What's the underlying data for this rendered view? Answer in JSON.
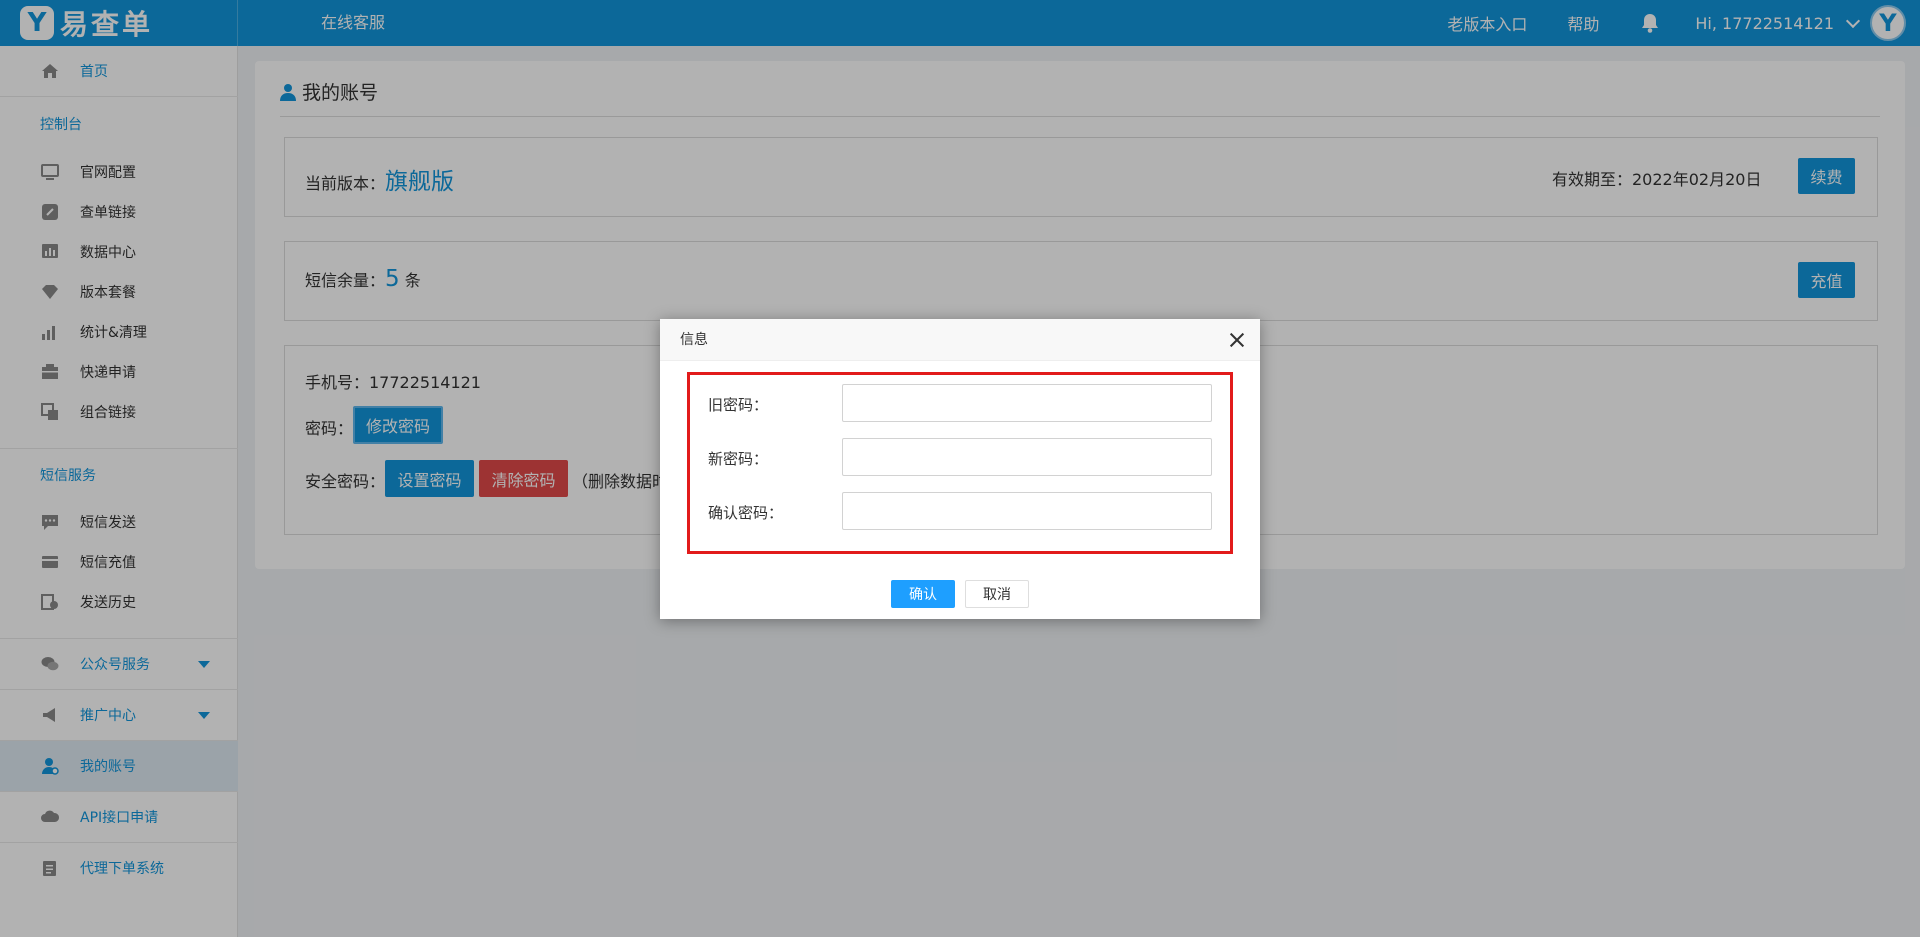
{
  "header": {
    "logo_mark": "Y",
    "logo_text": "易查单",
    "customer_service": "在线客服",
    "old_version": "老版本入口",
    "help": "帮助",
    "user_greeting": "Hi, 17722514121",
    "avatar_mark": "Y"
  },
  "sidebar": {
    "home": "首页",
    "section_console": "控制台",
    "console_items": [
      "官网配置",
      "查单链接",
      "数据中心",
      "版本套餐",
      "统计&清理",
      "快递申请",
      "组合链接"
    ],
    "section_sms": "短信服务",
    "sms_items": [
      "短信发送",
      "短信充值",
      "发送历史"
    ],
    "wechat_service": "公众号服务",
    "promotion_center": "推广中心",
    "my_account": "我的账号",
    "api_apply": "API接口申请",
    "agent_system": "代理下单系统"
  },
  "main": {
    "page_title": "我的账号",
    "version_label": "当前版本：",
    "version_value": "旗舰版",
    "expiry": "有效期至：2022年02月20日",
    "renew_button": "续费",
    "sms_label": "短信余量：",
    "sms_count": "5",
    "sms_unit": "条",
    "recharge_button": "充值",
    "phone": "手机号：17722514121",
    "password_label": "密码：",
    "change_password_button": "修改密码",
    "security_password_label": "安全密码：",
    "set_password_button": "设置密码",
    "clear_password_button": "清除密码",
    "security_note": "（删除数据时"
  },
  "modal": {
    "title": "信息",
    "old_password_label": "旧密码：",
    "new_password_label": "新密码：",
    "confirm_password_label": "确认密码：",
    "old_password_value": "",
    "new_password_value": "",
    "confirm_password_value": "",
    "ok_button": "确认",
    "cancel_button": "取消"
  },
  "colors": {
    "brand": "#1296db",
    "danger": "#e14a4a",
    "highlight_border": "#e21b1b",
    "primary_button": "#1e9fff"
  }
}
